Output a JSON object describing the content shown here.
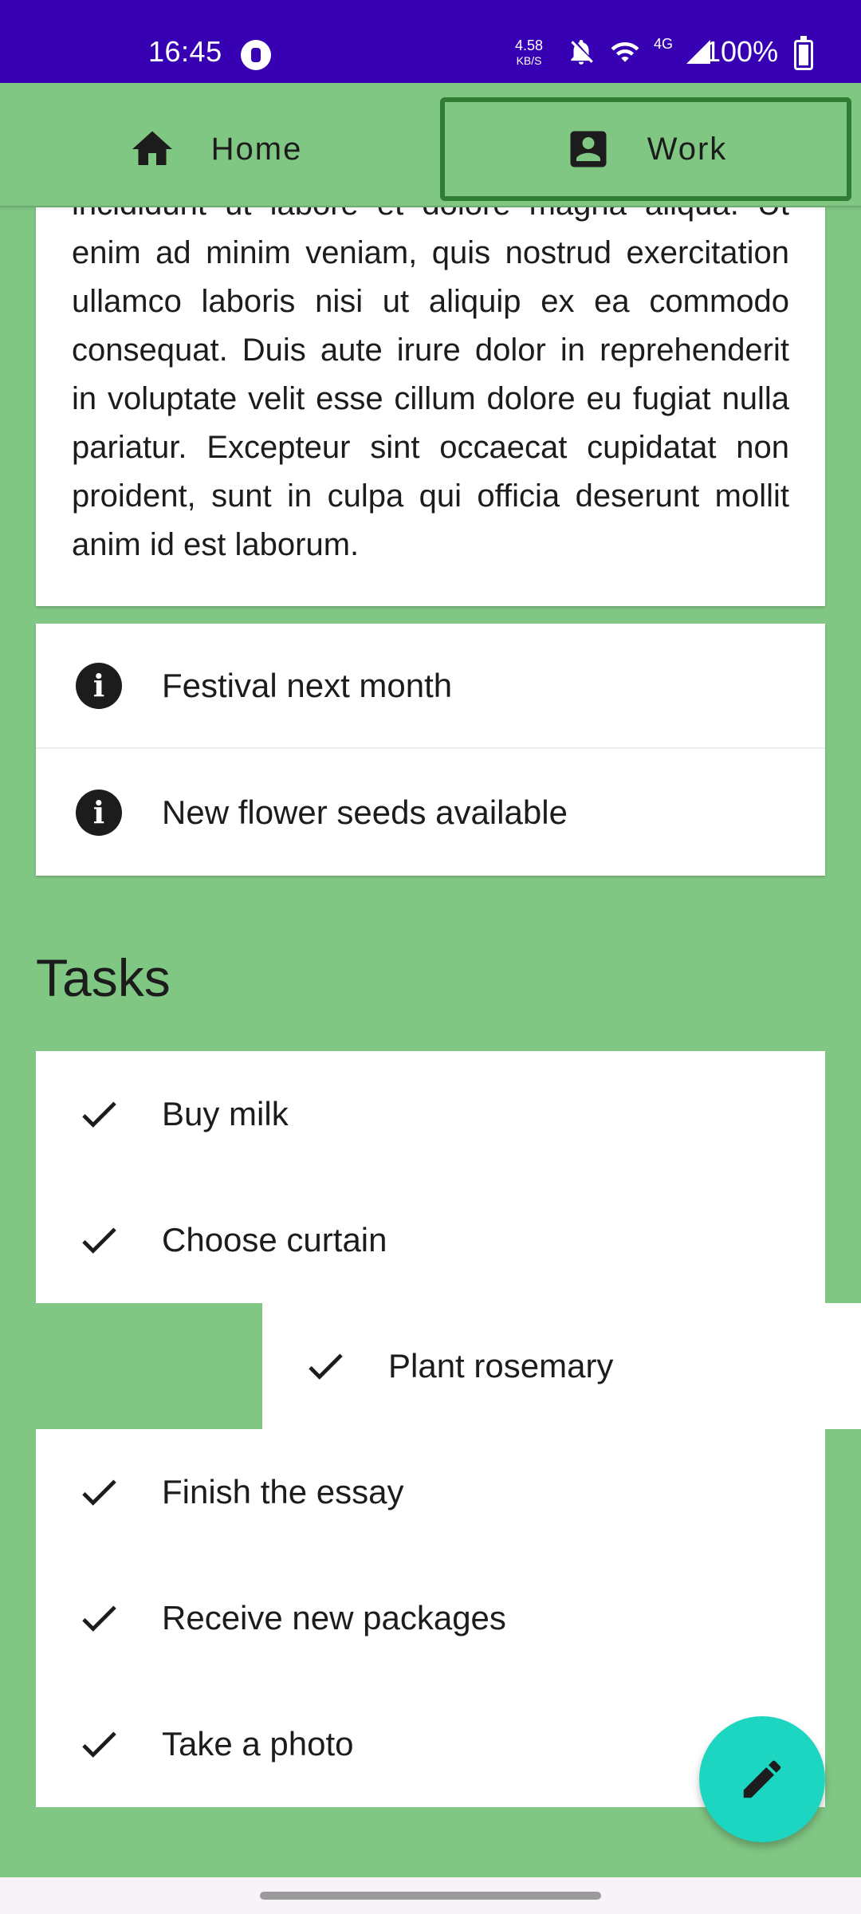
{
  "status_bar": {
    "time": "16:45",
    "net_speed_value": "4.58",
    "net_speed_unit": "KB/S",
    "network_type": "4G",
    "battery": "100%"
  },
  "tabs": [
    {
      "label": "Home",
      "icon": "home-icon"
    },
    {
      "label": "Work",
      "icon": "contact-card-icon",
      "selected": true
    }
  ],
  "lorem": {
    "text": "incididunt ut labore et dolore magna aliqua. Ut enim ad minim veniam, quis nostrud exercitation ullamco laboris nisi ut aliquip ex ea commodo consequat. Duis aute irure dolor in reprehenderit in voluptate velit esse cillum dolore eu fugiat nulla pariatur. Excepteur sint occaecat cupidatat non proident, sunt in culpa qui officia deserunt mollit anim id est laborum."
  },
  "info_items": [
    {
      "label": "Festival next month",
      "icon": "info-icon"
    },
    {
      "label": "New flower seeds available",
      "icon": "info-icon"
    }
  ],
  "tasks": {
    "title": "Tasks",
    "items": [
      {
        "label": "Buy milk",
        "icon": "check-icon"
      },
      {
        "label": "Choose curtain",
        "icon": "check-icon"
      },
      {
        "label": "Plant rosemary",
        "icon": "check-icon",
        "swiped": true
      },
      {
        "label": "Finish the essay",
        "icon": "check-icon"
      },
      {
        "label": "Receive new packages",
        "icon": "check-icon"
      },
      {
        "label": "Take a photo",
        "icon": "check-icon"
      }
    ]
  },
  "fab": {
    "icon": "edit-pencil-icon"
  },
  "colors": {
    "status_bar": "#3700B3",
    "background": "#81C784",
    "selected_tab_border": "#2E7D32",
    "fab": "#1DD6C1"
  }
}
